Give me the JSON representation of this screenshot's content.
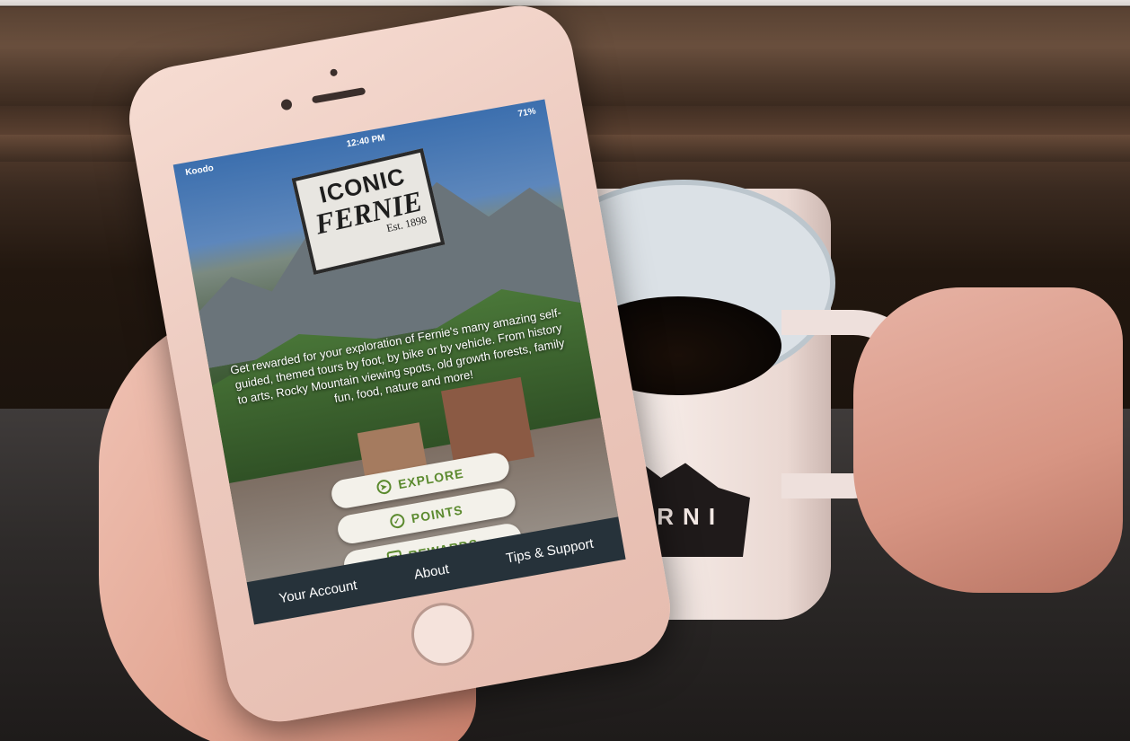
{
  "status_bar": {
    "carrier": "Koodo",
    "time": "12:40 PM",
    "battery": "71%"
  },
  "logo": {
    "line1": "ICONIC",
    "line2": "FERNIE",
    "line3": "Est. 1898"
  },
  "intro_text": "Get rewarded for your exploration of Fernie's many amazing self-guided, themed tours by foot, by bike or by vehicle. From history to arts, Rocky Mountain viewing spots, old growth forests, family fun, food, nature and more!",
  "buttons": {
    "explore": "EXPLORE",
    "points": "POINTS",
    "rewards": "REWARDS"
  },
  "tabs": {
    "account": "Your Account",
    "about": "About",
    "tips": "Tips & Support"
  },
  "mug": {
    "logo_text": "ERNI"
  },
  "colors": {
    "accent_green": "#5b8a2e",
    "pill_bg": "#f3f1ea",
    "tabbar_bg": "#26323a",
    "phone_rose_gold": "#edcbc0"
  }
}
